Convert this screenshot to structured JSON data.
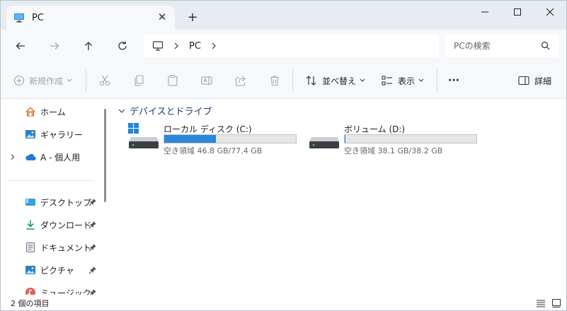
{
  "tab": {
    "title": "PC"
  },
  "address": {
    "crumb": "PC"
  },
  "search": {
    "placeholder": "PCの検索"
  },
  "commands": {
    "new": "新規作成",
    "sort": "並べ替え",
    "view": "表示",
    "more": "···",
    "details": "詳細"
  },
  "sidebar": {
    "items": [
      {
        "label": "ホーム",
        "icon": "home-icon"
      },
      {
        "label": "ギャラリー",
        "icon": "gallery-icon"
      },
      {
        "label": "A - 個人用",
        "icon": "onedrive-cloud-icon"
      },
      {
        "label": "デスクトップ",
        "icon": "desktop-icon"
      },
      {
        "label": "ダウンロード",
        "icon": "download-icon"
      },
      {
        "label": "ドキュメント",
        "icon": "document-icon"
      },
      {
        "label": "ピクチャ",
        "icon": "pictures-icon"
      },
      {
        "label": "ミュージック",
        "icon": "music-icon"
      }
    ]
  },
  "main": {
    "group": "デバイスとドライブ",
    "drives": [
      {
        "name": "ローカル ディスク (C:)",
        "size_text": "空き領域 46.8 GB/77.4 GB",
        "used_fraction": 0.395
      },
      {
        "name": "ボリューム (D:)",
        "size_text": "空き領域 38.1 GB/38.2 GB",
        "used_fraction": 0.003
      }
    ]
  },
  "status": {
    "item_count": "2 個の項目"
  },
  "colors": {
    "accent": "#2b88d8",
    "titlebar": "#e7ecf2",
    "toolbar": "#f6f8fb"
  }
}
